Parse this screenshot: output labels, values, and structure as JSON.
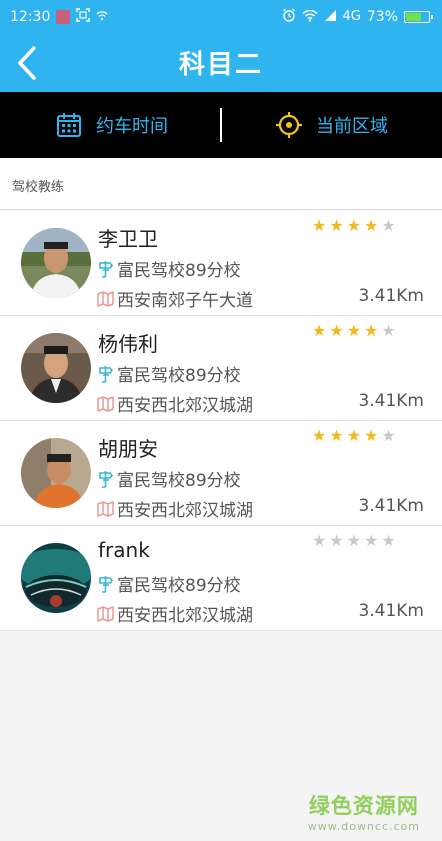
{
  "status_bar": {
    "time": "12:30",
    "network": "4G",
    "battery": "73%",
    "battery_level": 0.73,
    "icons": [
      "notification-icon",
      "screenshot-icon",
      "wifi-signal-icon",
      "alarm-icon",
      "wifi-icon",
      "cell-signal-icon",
      "battery-icon"
    ]
  },
  "header": {
    "title": "科目二",
    "back_icon": "chevron-left-icon"
  },
  "tabs": [
    {
      "label": "约车时间",
      "icon": "calendar-icon"
    },
    {
      "label": "当前区域",
      "icon": "location-target-icon"
    }
  ],
  "section": {
    "title": "驾校教练"
  },
  "coaches": [
    {
      "name": "李卫卫",
      "school": "富民驾校89分校",
      "address": "西安南郊子午大道",
      "distance": "3.41Km",
      "rating": 4,
      "max_rating": 5
    },
    {
      "name": "杨伟利",
      "school": "富民驾校89分校",
      "address": "西安西北郊汉城湖",
      "distance": "3.41Km",
      "rating": 4,
      "max_rating": 5
    },
    {
      "name": "胡朋安",
      "school": "富民驾校89分校",
      "address": "西安西北郊汉城湖",
      "distance": "3.41Km",
      "rating": 4,
      "max_rating": 5
    },
    {
      "name": "frank",
      "school": "富民驾校89分校",
      "address": "西安西北郊汉城湖",
      "distance": "3.41Km",
      "rating": 0,
      "max_rating": 5
    }
  ],
  "watermark": {
    "main": "绿色资源网",
    "sub": "www.downcc.com"
  },
  "colors": {
    "primary": "#2fb4f0",
    "star_on": "#f2b91f",
    "star_off": "#c9c9c9",
    "tab_bar": "#000000"
  }
}
